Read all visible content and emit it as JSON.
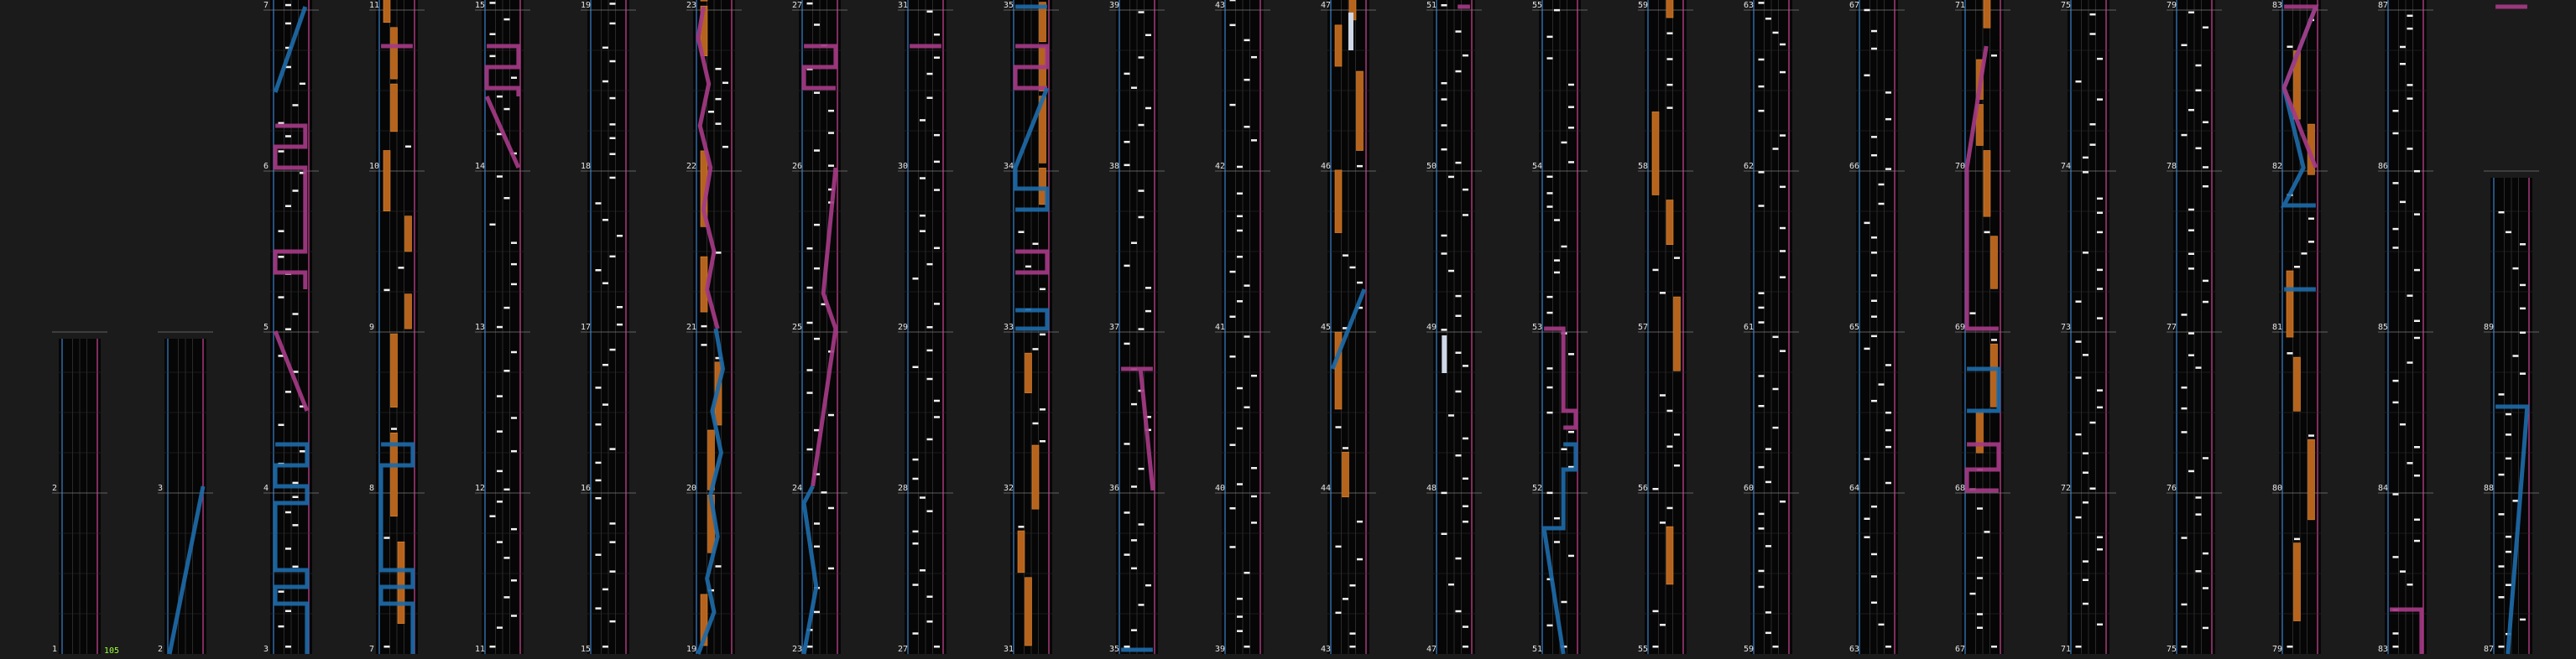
{
  "colors": {
    "background": "#1b1b1b",
    "lane_bg": "#060606",
    "lane_line": "#2a2a2a",
    "beat_line": "#2c2c2c",
    "measure_line": "#7a7a7a",
    "left_edge": "#2f6aa6",
    "right_edge": "#a8387a",
    "note": "#f2f2f2",
    "hold": "#b5631d",
    "hold_edge": "#e88a2e",
    "laser_left": "#1d6aa8",
    "laser_right": "#a53a86",
    "bpm_text": "#9bff3b",
    "chip_fx": "#f07a1e",
    "held_button": "#cfd8e6"
  },
  "bpm": "105",
  "measures": [
    {
      "n": "1",
      "col": 0,
      "row": 0
    },
    {
      "n": "2",
      "col": 0,
      "row": 1
    },
    {
      "n": "2",
      "col": 1,
      "row": 0
    },
    {
      "n": "3",
      "col": 1,
      "row": 1
    },
    {
      "n": "3",
      "col": 2,
      "row": 0
    },
    {
      "n": "4",
      "col": 2,
      "row": 1
    },
    {
      "n": "5",
      "col": 2,
      "row": 2
    },
    {
      "n": "6",
      "col": 2,
      "row": 3
    },
    {
      "n": "7",
      "col": 2,
      "row": 4
    },
    {
      "n": "7",
      "col": 3,
      "row": 0
    },
    {
      "n": "8",
      "col": 3,
      "row": 1
    },
    {
      "n": "9",
      "col": 3,
      "row": 2
    },
    {
      "n": "10",
      "col": 3,
      "row": 3
    },
    {
      "n": "11",
      "col": 3,
      "row": 4
    },
    {
      "n": "11",
      "col": 4,
      "row": 0
    },
    {
      "n": "12",
      "col": 4,
      "row": 1
    },
    {
      "n": "13",
      "col": 4,
      "row": 2
    },
    {
      "n": "14",
      "col": 4,
      "row": 3
    },
    {
      "n": "15",
      "col": 4,
      "row": 4
    },
    {
      "n": "15",
      "col": 5,
      "row": 0
    },
    {
      "n": "16",
      "col": 5,
      "row": 1
    },
    {
      "n": "17",
      "col": 5,
      "row": 2
    },
    {
      "n": "18",
      "col": 5,
      "row": 3
    },
    {
      "n": "19",
      "col": 5,
      "row": 4
    },
    {
      "n": "19",
      "col": 6,
      "row": 0
    },
    {
      "n": "20",
      "col": 6,
      "row": 1
    },
    {
      "n": "21",
      "col": 6,
      "row": 2
    },
    {
      "n": "22",
      "col": 6,
      "row": 3
    },
    {
      "n": "23",
      "col": 6,
      "row": 4
    },
    {
      "n": "23",
      "col": 7,
      "row": 0
    },
    {
      "n": "24",
      "col": 7,
      "row": 1
    },
    {
      "n": "25",
      "col": 7,
      "row": 2
    },
    {
      "n": "26",
      "col": 7,
      "row": 3
    },
    {
      "n": "27",
      "col": 7,
      "row": 4
    },
    {
      "n": "27",
      "col": 8,
      "row": 0
    },
    {
      "n": "28",
      "col": 8,
      "row": 1
    },
    {
      "n": "29",
      "col": 8,
      "row": 2
    },
    {
      "n": "30",
      "col": 8,
      "row": 3
    },
    {
      "n": "31",
      "col": 8,
      "row": 4
    },
    {
      "n": "31",
      "col": 9,
      "row": 0
    },
    {
      "n": "32",
      "col": 9,
      "row": 1
    },
    {
      "n": "33",
      "col": 9,
      "row": 2
    },
    {
      "n": "34",
      "col": 9,
      "row": 3
    },
    {
      "n": "35",
      "col": 9,
      "row": 4
    },
    {
      "n": "35",
      "col": 10,
      "row": 0
    },
    {
      "n": "36",
      "col": 10,
      "row": 1
    },
    {
      "n": "37",
      "col": 10,
      "row": 2
    },
    {
      "n": "38",
      "col": 10,
      "row": 3
    },
    {
      "n": "39",
      "col": 10,
      "row": 4
    },
    {
      "n": "39",
      "col": 11,
      "row": 0
    },
    {
      "n": "40",
      "col": 11,
      "row": 1
    },
    {
      "n": "41",
      "col": 11,
      "row": 2
    },
    {
      "n": "42",
      "col": 11,
      "row": 3
    },
    {
      "n": "43",
      "col": 11,
      "row": 4
    },
    {
      "n": "43",
      "col": 12,
      "row": 0
    },
    {
      "n": "44",
      "col": 12,
      "row": 1
    },
    {
      "n": "45",
      "col": 12,
      "row": 2
    },
    {
      "n": "46",
      "col": 12,
      "row": 3
    },
    {
      "n": "47",
      "col": 12,
      "row": 4
    },
    {
      "n": "47",
      "col": 13,
      "row": 0
    },
    {
      "n": "48",
      "col": 13,
      "row": 1
    },
    {
      "n": "49",
      "col": 13,
      "row": 2
    },
    {
      "n": "50",
      "col": 13,
      "row": 3
    },
    {
      "n": "51",
      "col": 13,
      "row": 4
    },
    {
      "n": "51",
      "col": 14,
      "row": 0
    },
    {
      "n": "52",
      "col": 14,
      "row": 1
    },
    {
      "n": "53",
      "col": 14,
      "row": 2
    },
    {
      "n": "54",
      "col": 14,
      "row": 3
    },
    {
      "n": "55",
      "col": 14,
      "row": 4
    },
    {
      "n": "55",
      "col": 15,
      "row": 0
    },
    {
      "n": "56",
      "col": 15,
      "row": 1
    },
    {
      "n": "57",
      "col": 15,
      "row": 2
    },
    {
      "n": "58",
      "col": 15,
      "row": 3
    },
    {
      "n": "59",
      "col": 15,
      "row": 4
    },
    {
      "n": "59",
      "col": 16,
      "row": 0
    },
    {
      "n": "60",
      "col": 16,
      "row": 1
    },
    {
      "n": "61",
      "col": 16,
      "row": 2
    },
    {
      "n": "62",
      "col": 16,
      "row": 3
    },
    {
      "n": "63",
      "col": 16,
      "row": 4
    },
    {
      "n": "63",
      "col": 17,
      "row": 0
    },
    {
      "n": "64",
      "col": 17,
      "row": 1
    },
    {
      "n": "65",
      "col": 17,
      "row": 2
    },
    {
      "n": "66",
      "col": 17,
      "row": 3
    },
    {
      "n": "67",
      "col": 17,
      "row": 4
    },
    {
      "n": "67",
      "col": 18,
      "row": 0
    },
    {
      "n": "68",
      "col": 18,
      "row": 1
    },
    {
      "n": "69",
      "col": 18,
      "row": 2
    },
    {
      "n": "70",
      "col": 18,
      "row": 3
    },
    {
      "n": "71",
      "col": 18,
      "row": 4
    },
    {
      "n": "71",
      "col": 19,
      "row": 0
    },
    {
      "n": "72",
      "col": 19,
      "row": 1
    },
    {
      "n": "73",
      "col": 19,
      "row": 2
    },
    {
      "n": "74",
      "col": 19,
      "row": 3
    },
    {
      "n": "75",
      "col": 19,
      "row": 4
    },
    {
      "n": "75",
      "col": 20,
      "row": 0
    },
    {
      "n": "76",
      "col": 20,
      "row": 1
    },
    {
      "n": "77",
      "col": 20,
      "row": 2
    },
    {
      "n": "78",
      "col": 20,
      "row": 3
    },
    {
      "n": "79",
      "col": 20,
      "row": 4
    },
    {
      "n": "79",
      "col": 21,
      "row": 0
    },
    {
      "n": "80",
      "col": 21,
      "row": 1
    },
    {
      "n": "81",
      "col": 21,
      "row": 2
    },
    {
      "n": "82",
      "col": 21,
      "row": 3
    },
    {
      "n": "83",
      "col": 21,
      "row": 4
    },
    {
      "n": "83",
      "col": 22,
      "row": 0
    },
    {
      "n": "84",
      "col": 22,
      "row": 1
    },
    {
      "n": "85",
      "col": 22,
      "row": 2
    },
    {
      "n": "86",
      "col": 22,
      "row": 3
    },
    {
      "n": "87",
      "col": 22,
      "row": 4
    },
    {
      "n": "87",
      "col": 23,
      "row": 0
    },
    {
      "n": "88",
      "col": 23,
      "row": 1
    },
    {
      "n": "89",
      "col": 23,
      "row": 2
    }
  ]
}
